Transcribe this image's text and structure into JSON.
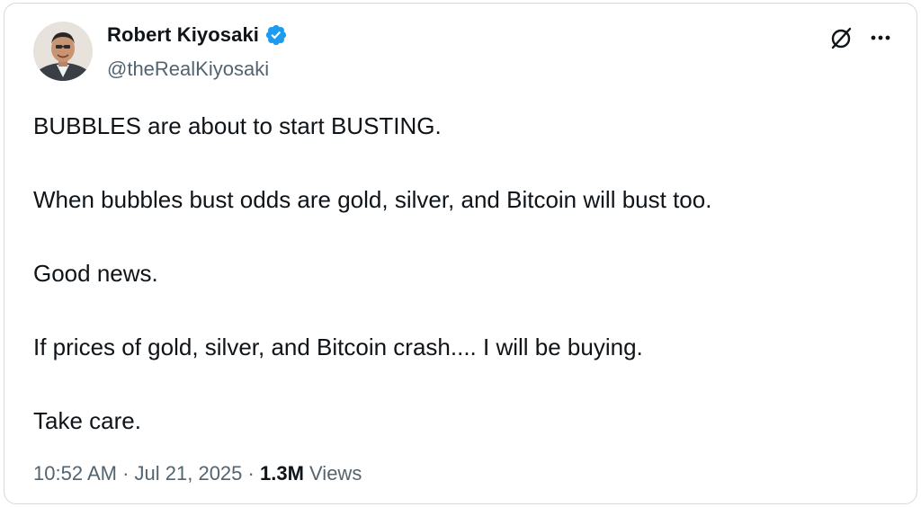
{
  "author": {
    "display_name": "Robert Kiyosaki",
    "handle": "@theRealKiyosaki",
    "verified": true,
    "avatar_icon": "profile-photo"
  },
  "actions": {
    "grok_icon": "grok-slash-circle-icon",
    "more_icon": "more-horizontal-icon"
  },
  "tweet": {
    "paragraphs": [
      "BUBBLES are about to start BUSTING.",
      "When bubbles bust odds are gold, silver, and Bitcoin will bust too.",
      "Good news.",
      "If prices of gold, silver, and Bitcoin crash.... I will be buying.",
      "Take care."
    ]
  },
  "meta": {
    "time": "10:52 AM",
    "separator": "·",
    "date": "Jul 21, 2025",
    "views_count": "1.3M",
    "views_label": "Views"
  },
  "colors": {
    "text_primary": "#0f1419",
    "text_secondary": "#536471",
    "verified_blue": "#1d9bf0",
    "border": "#d4d9de"
  }
}
